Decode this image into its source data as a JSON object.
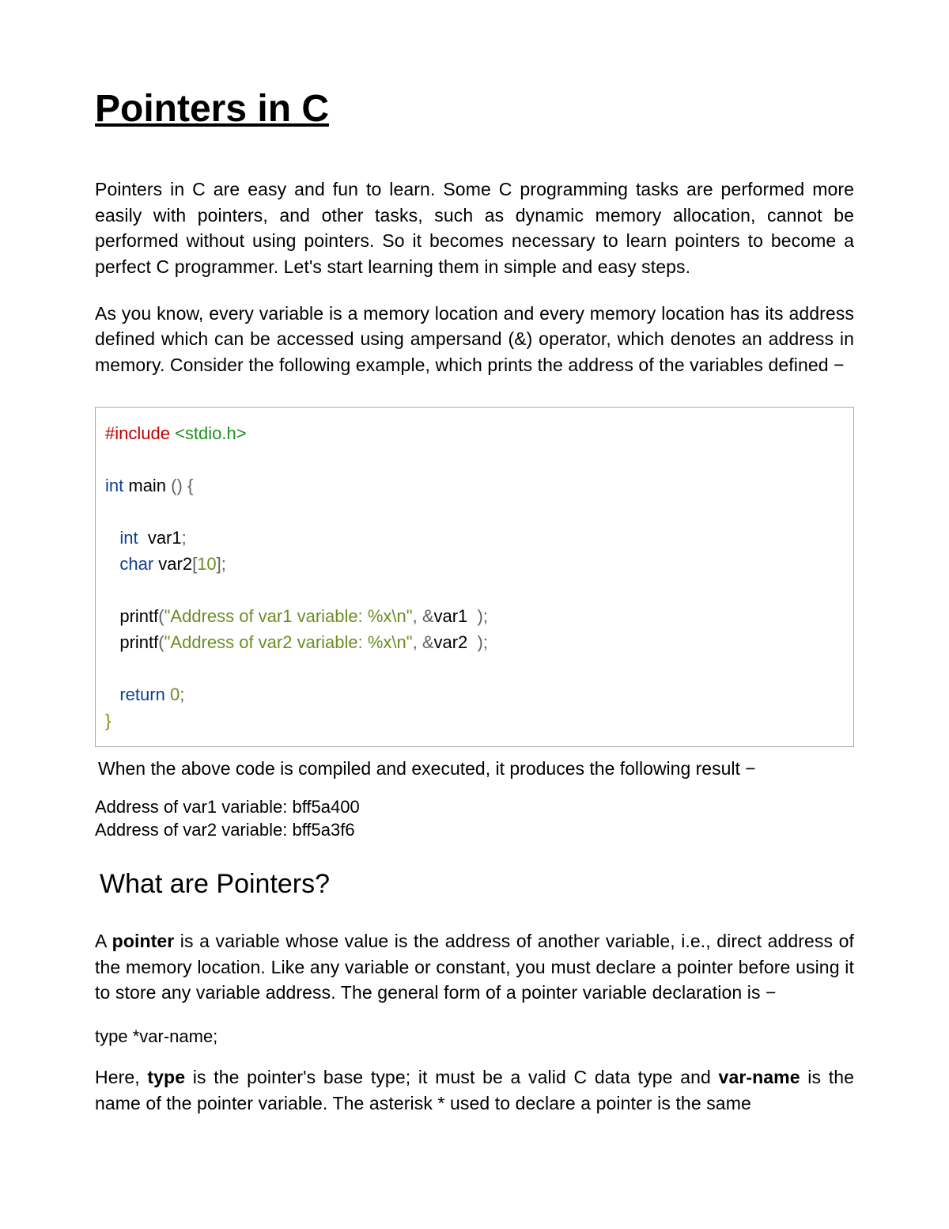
{
  "title": "Pointers in C",
  "intro": {
    "p1": "Pointers in C are easy and fun to learn. Some C programming tasks are performed more easily with pointers, and other tasks, such as dynamic memory allocation, cannot be performed without using pointers. So it becomes necessary to learn pointers to become a perfect C programmer. Let's start learning them in simple and easy steps.",
    "p2": "As you know, every variable is a memory location and every memory location has its address defined which can be accessed using ampersand (&) operator, which denotes an address in memory. Consider the following example, which prints the address of the variables defined −"
  },
  "code1": {
    "preproc": "#include",
    "sysheader": "<stdio.h>",
    "kw_int": "int",
    "fn_main": " main ",
    "open_paren": "()",
    "open_brace": " {",
    "decl_int": "int",
    "decl_var1": "  var1",
    "semi": ";",
    "decl_char": "char",
    "decl_var2": " var2",
    "arr_open": "[",
    "arr_size": "10",
    "arr_close": "]",
    "printf1_fn": "printf",
    "printf1_open": "(",
    "printf1_str": "\"Address of var1 variable: %x\\n\"",
    "printf1_comma": ",",
    "printf1_amp": " &",
    "printf1_arg": "var1  ",
    "printf1_close": ");",
    "printf2_fn": "printf",
    "printf2_open": "(",
    "printf2_str": "\"Address of var2 variable: %x\\n\"",
    "printf2_comma": ",",
    "printf2_amp": " &",
    "printf2_arg": "var2  ",
    "printf2_close": ");",
    "kw_return": "return",
    "ret_val": " 0",
    "ret_semi": ";",
    "close_brace": "}"
  },
  "result_intro": "When the above code is compiled and executed, it produces the following result −",
  "output": "Address of var1 variable: bff5a400\nAddress of var2 variable: bff5a3f6",
  "section2": {
    "heading": "What are Pointers?",
    "p_pre": "A ",
    "p_bold": "pointer",
    "p_rest": " is a variable whose value is the address of another variable, i.e., direct address of the memory location. Like any variable or constant, you must declare a pointer before using it to store any variable address. The general form of a pointer variable declaration is −",
    "decl": "type *var-name;",
    "p2_pre": "Here, ",
    "p2_bold1": "type",
    "p2_mid": " is the pointer's base type; it must be a valid C data type and ",
    "p2_bold2": "var-name",
    "p2_rest": " is the name of the pointer variable. The asterisk * used to declare a pointer is the same"
  }
}
